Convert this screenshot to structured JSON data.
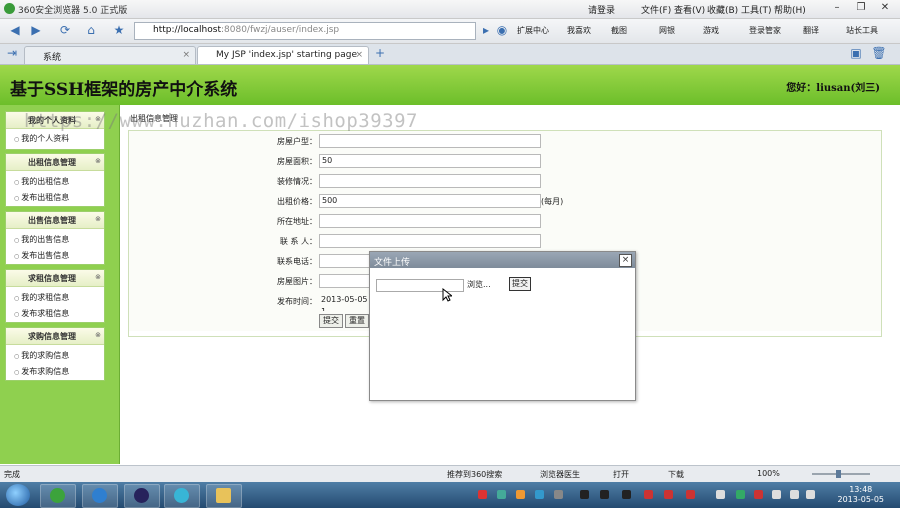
{
  "browser": {
    "title": "360安全浏览器 5.0 正式版",
    "menus": [
      "文件(F)",
      "查看(V)",
      "收藏(B)",
      "工具(T)",
      "帮助(H)"
    ],
    "login": "请登录",
    "url_host": "http://localhost",
    "url_rest": ":8080/fwzj/auser/index.jsp",
    "toolbar": [
      "扩展中心",
      "我喜欢",
      "截图",
      "网银",
      "游戏",
      "登录管家",
      "翻译",
      "站长工具"
    ],
    "tabs": [
      {
        "label": "系统",
        "active": false
      },
      {
        "label": "My JSP 'index.jsp' starting page",
        "active": true
      }
    ]
  },
  "page": {
    "title": "基于SSH框架的房产中介系统",
    "greeting": "您好：liusan(刘三)"
  },
  "sidebar": [
    {
      "title": "我的个人资料",
      "items": [
        "我的个人资料"
      ]
    },
    {
      "title": "出租信息管理",
      "items": [
        "我的出租信息",
        "发布出租信息"
      ]
    },
    {
      "title": "出售信息管理",
      "items": [
        "我的出售信息",
        "发布出售信息"
      ]
    },
    {
      "title": "求租信息管理",
      "items": [
        "我的求租信息",
        "发布求租信息"
      ]
    },
    {
      "title": "求购信息管理",
      "items": [
        "我的求购信息",
        "发布求购信息"
      ]
    }
  ],
  "main": {
    "breadcrumb": "出租信息管理",
    "form": {
      "fields": [
        {
          "label": "房屋户型：",
          "value": ""
        },
        {
          "label": "房屋面积：",
          "value": "50"
        },
        {
          "label": "装修情况：",
          "value": ""
        },
        {
          "label": "出租价格：",
          "value": "500",
          "suffix": "(每月)"
        },
        {
          "label": "所在地址：",
          "value": ""
        },
        {
          "label": "联 系 人：",
          "value": ""
        },
        {
          "label": "联系电话：",
          "value": ""
        },
        {
          "label": "房屋图片：",
          "value": ""
        },
        {
          "label": "发布时间：",
          "value": "2013-05-05 1"
        }
      ],
      "submit": "提交",
      "reset": "重置"
    }
  },
  "dialog": {
    "title": "文件上传",
    "browse": "浏览...",
    "submit": "提交"
  },
  "watermark": "https://www.huzhan.com/ishop39397",
  "statusbar": {
    "status": "完成",
    "recommend": "推荐到360搜索",
    "doctor": "浏览器医生",
    "open": "打开",
    "download": "下载",
    "zoom": "100%"
  },
  "taskbar": {
    "time": "13:48",
    "date": "2013-05-05"
  },
  "colors": {
    "header_green": "#8cc84b",
    "sidebar_green": "#8fd04f",
    "taskbar_blue": "#2f5a82"
  }
}
